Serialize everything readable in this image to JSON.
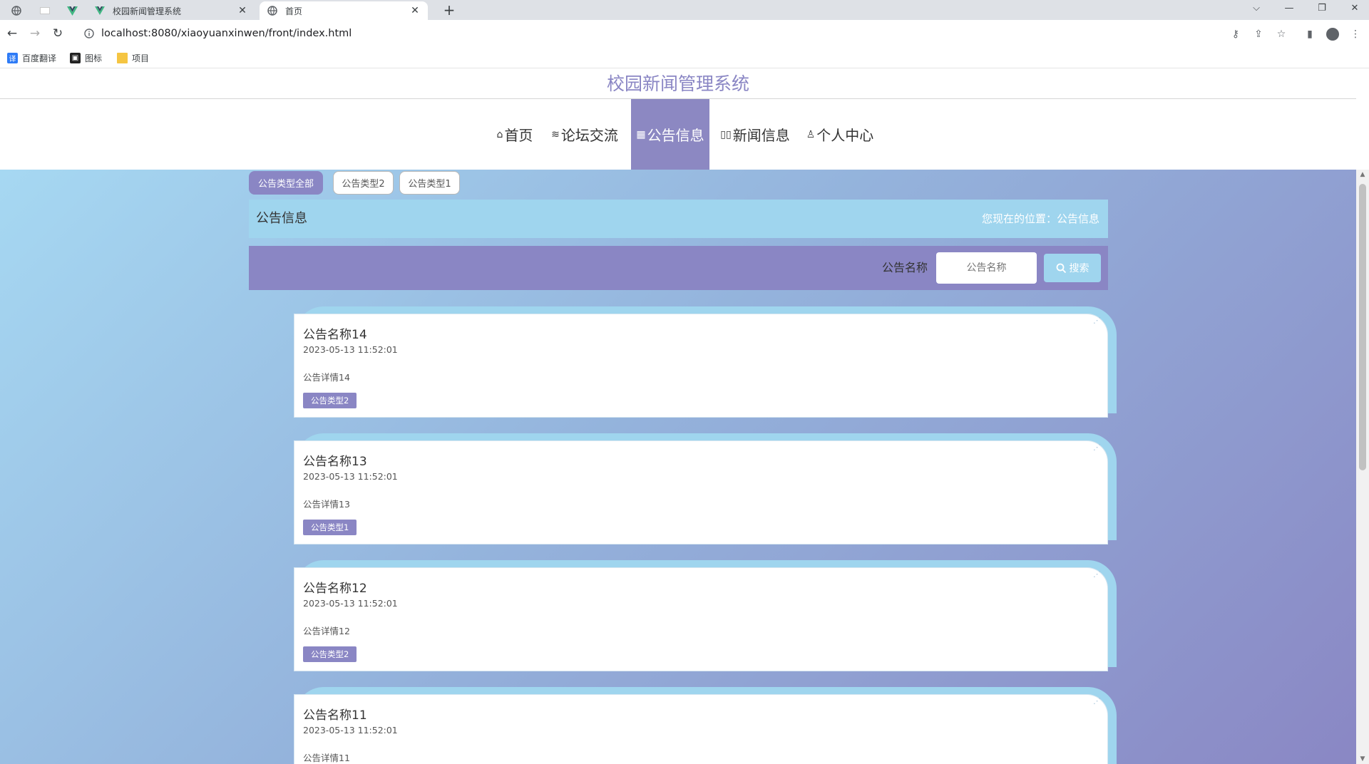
{
  "browser": {
    "tabs": [
      {
        "title": "校园新闻管理系统",
        "active": false
      },
      {
        "title": "首页",
        "active": true
      }
    ],
    "url": "localhost:8080/xiaoyuanxinwen/front/index.html",
    "bookmarks": [
      "百度翻译",
      "图标",
      "项目"
    ]
  },
  "site": {
    "title": "校园新闻管理系统",
    "nav": [
      {
        "icon": "⌂",
        "label": "首页"
      },
      {
        "icon": "≋",
        "label": "论坛交流"
      },
      {
        "icon": "▦",
        "label": "公告信息",
        "active": true
      },
      {
        "icon": "▯▯",
        "label": "新闻信息"
      },
      {
        "icon": "♙",
        "label": "个人中心"
      }
    ]
  },
  "filters": [
    "公告类型全部",
    "公告类型2",
    "公告类型1"
  ],
  "crumb": {
    "page_title": "公告信息",
    "location": "您现在的位置：公告信息"
  },
  "search": {
    "label": "公告名称",
    "placeholder": "公告名称",
    "button": "搜索"
  },
  "notices": [
    {
      "name": "公告名称14",
      "time": "2023-05-13 11:52:01",
      "detail": "公告详情14",
      "type": "公告类型2"
    },
    {
      "name": "公告名称13",
      "time": "2023-05-13 11:52:01",
      "detail": "公告详情13",
      "type": "公告类型1"
    },
    {
      "name": "公告名称12",
      "time": "2023-05-13 11:52:01",
      "detail": "公告详情12",
      "type": "公告类型2"
    },
    {
      "name": "公告名称11",
      "time": "2023-05-13 11:52:01",
      "detail": "公告详情11",
      "type": ""
    }
  ],
  "colors": {
    "accent": "#8a86c4",
    "light_blue": "#9fd5ee"
  }
}
